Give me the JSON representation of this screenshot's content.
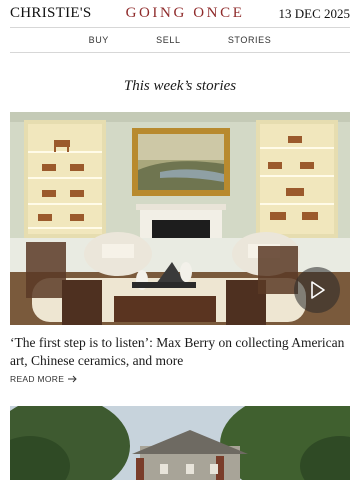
{
  "header": {
    "brand": "CHRISTIE'S",
    "tagline": "GOING ONCE",
    "date": "13 DEC 2025"
  },
  "nav": {
    "items": [
      {
        "label": "BUY"
      },
      {
        "label": "SELL"
      },
      {
        "label": "STORIES"
      }
    ]
  },
  "section": {
    "title": "This week’s stories"
  },
  "stories": [
    {
      "headline": "‘The first step is to listen’: Max Berry on collecting American art, Chinese ceramics, and more",
      "read_more": "READ MORE",
      "image": "interior-room-with-painting-and-ceramic-horses",
      "has_video": true
    },
    {
      "image": "house-with-trees-exterior"
    }
  ],
  "colors": {
    "tagline": "#8f2b2b",
    "divider": "#d7d7d7"
  },
  "icons": {
    "play": "play-icon",
    "arrow": "arrow-right-icon"
  }
}
